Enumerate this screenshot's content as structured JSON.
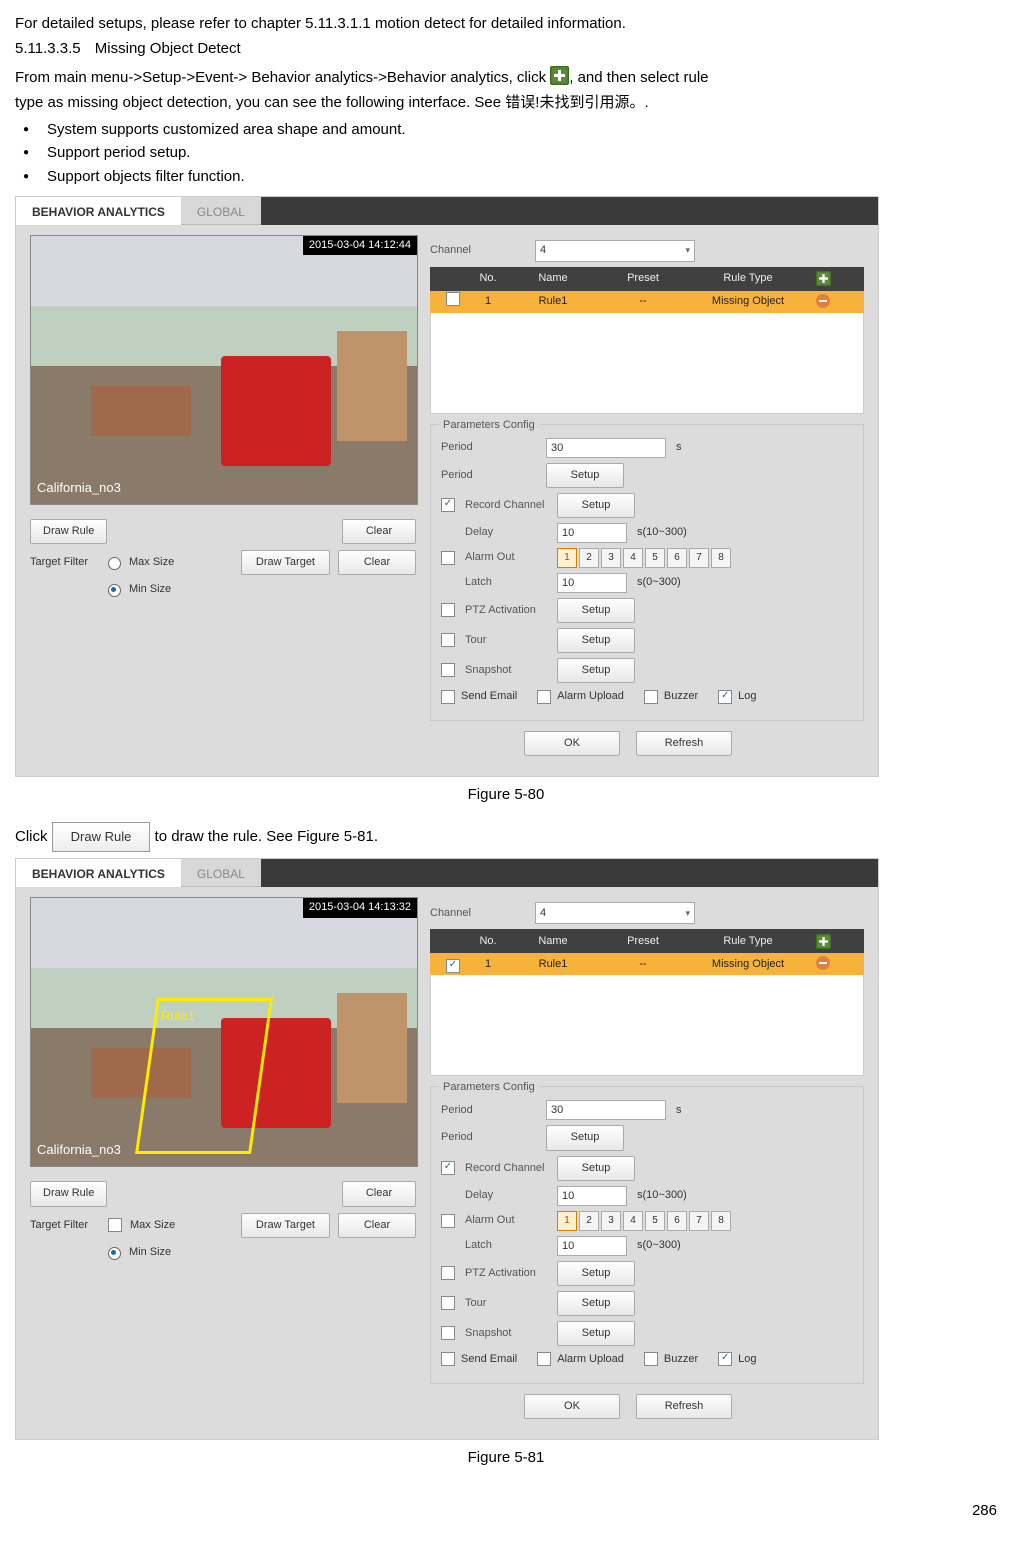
{
  "intro": {
    "line1": "For detailed setups, please refer to chapter 5.11.3.1.1 motion detect for detailed information.",
    "sec_num": "5.11.3.3.5",
    "sec_title": "Missing Object Detect",
    "nav_a": "From main menu->Setup->Event-> Behavior analytics->Behavior analytics, click",
    "nav_b": ", and then select rule",
    "nav_c": "type as missing object detection, you can see the following interface. See ",
    "err": "错误!未找到引用源。",
    "nav_d": ".",
    "bul1": "System supports customized area shape and amount.",
    "bul2": "Support period setup.",
    "bul3": "Support objects filter function."
  },
  "shot": {
    "tab_active": "BEHAVIOR ANALYTICS",
    "tab_inactive": "GLOBAL",
    "ts1": "2015-03-04 14:12:44",
    "ts2": "2015-03-04 14:13:32",
    "cam": "California_no3",
    "rule_label": "Rule1",
    "draw_rule": "Draw Rule",
    "clear": "Clear",
    "target_filter": "Target Filter",
    "max": "Max Size",
    "min": "Min Size",
    "draw_target": "Draw Target",
    "channel_lbl": "Channel",
    "channel_val": "4",
    "hdr_no": "No.",
    "hdr_name": "Name",
    "hdr_preset": "Preset",
    "hdr_type": "Rule Type",
    "row_no": "1",
    "row_name": "Rule1",
    "row_preset": "--",
    "row_type": "Missing Object",
    "params_legend": "Parameters Config",
    "period_lbl": "Period",
    "period_val": "30",
    "period_unit": "s",
    "setup": "Setup",
    "rec_ch": "Record Channel",
    "delay": "Delay",
    "delay_val": "10",
    "delay_unit": "s(10~300)",
    "alarm_out": "Alarm Out",
    "latch": "Latch",
    "latch_val": "10",
    "latch_unit": "s(0~300)",
    "ptz": "PTZ Activation",
    "tour": "Tour",
    "snapshot": "Snapshot",
    "send_email": "Send Email",
    "alarm_upload": "Alarm Upload",
    "buzzer": "Buzzer",
    "log": "Log",
    "ok": "OK",
    "refresh": "Refresh",
    "n1": "1",
    "n2": "2",
    "n3": "3",
    "n4": "4",
    "n5": "5",
    "n6": "6",
    "n7": "7",
    "n8": "8"
  },
  "captions": {
    "fig80": "Figure 5-80",
    "fig81": "Figure 5-81"
  },
  "mid": {
    "a": "Click ",
    "btn": "Draw Rule",
    "b": " to draw the rule. See Figure 5-81."
  },
  "page": "286"
}
